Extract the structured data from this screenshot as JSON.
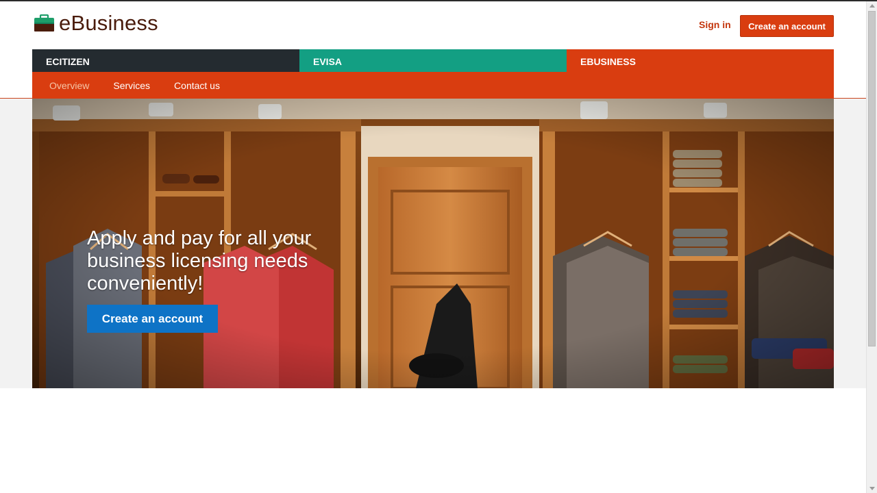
{
  "brand": {
    "name": "eBusiness",
    "icon": "briefcase-icon",
    "icon_color": "#1e9e6a"
  },
  "header": {
    "signin_label": "Sign in",
    "create_account_label": "Create an account"
  },
  "tabs": [
    {
      "label": "ECITIZEN",
      "color": "#242b30"
    },
    {
      "label": "EVISA",
      "color": "#139f83"
    },
    {
      "label": "EBUSINESS",
      "color": "#d93d10"
    }
  ],
  "subnav": {
    "items": [
      "Overview",
      "Services",
      "Contact us"
    ],
    "active": "Overview"
  },
  "hero": {
    "headline": "Apply and pay for all your business licensing needs conveniently!",
    "cta_label": "Create an account",
    "cta_color": "#0e73c6"
  },
  "colors": {
    "accent": "#d93d10",
    "brand_text": "#4a1c0c",
    "signin": "#c3350c"
  }
}
